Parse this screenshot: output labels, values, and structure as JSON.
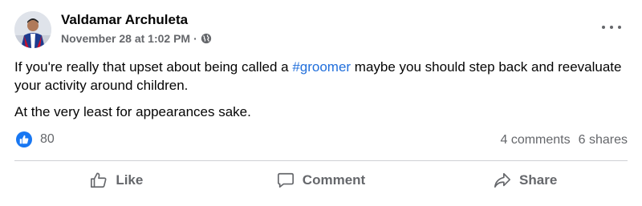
{
  "post": {
    "author": "Valdamar Archuleta",
    "timestamp": "November 28 at 1:02 PM",
    "separator": "·",
    "audience_icon": "globe-icon",
    "paragraphs": {
      "p1_before": "If you're really that upset about being called a ",
      "p1_hashtag": "#groomer",
      "p1_after": " maybe you should step back and reevaluate your activity around children.",
      "p2": "At the very least for appearances sake."
    },
    "reactions": {
      "icon": "like-icon",
      "count": "80"
    },
    "comments": "4 comments",
    "shares": "6 shares"
  },
  "actions": {
    "like": "Like",
    "comment": "Comment",
    "share": "Share"
  },
  "colors": {
    "hashtag": "#216fdb",
    "like_badge": "#1877f2",
    "secondary_text": "#65676b"
  }
}
